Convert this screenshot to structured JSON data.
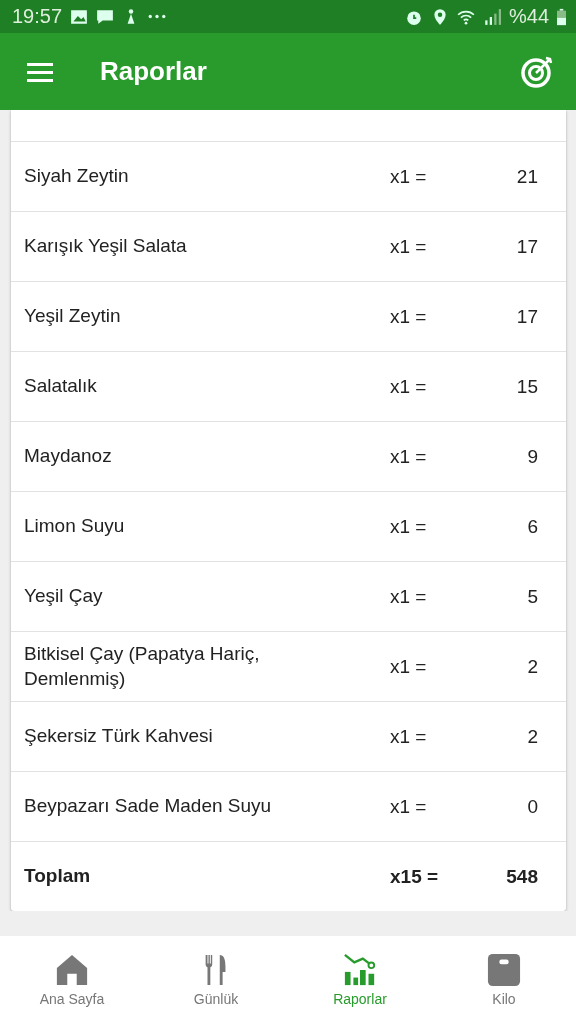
{
  "status_bar": {
    "time": "19:57",
    "battery": "%44"
  },
  "app_bar": {
    "title": "Raporlar"
  },
  "rows": [
    {
      "name": "Siyah Zeytin",
      "qty": "x1 =",
      "value": "21"
    },
    {
      "name": "Karışık Yeşil Salata",
      "qty": "x1 =",
      "value": "17"
    },
    {
      "name": "Yeşil Zeytin",
      "qty": "x1 =",
      "value": "17"
    },
    {
      "name": "Salatalık",
      "qty": "x1 =",
      "value": "15"
    },
    {
      "name": "Maydanoz",
      "qty": "x1 =",
      "value": "9"
    },
    {
      "name": "Limon Suyu",
      "qty": "x1 =",
      "value": "6"
    },
    {
      "name": "Yeşil Çay",
      "qty": "x1 =",
      "value": "5"
    },
    {
      "name": "Bitkisel Çay (Papatya Hariç, Demlenmiş)",
      "qty": "x1 =",
      "value": "2"
    },
    {
      "name": "Şekersiz Türk Kahvesi",
      "qty": "x1 =",
      "value": "2"
    },
    {
      "name": "Beypazarı Sade Maden Suyu",
      "qty": "x1 =",
      "value": "0"
    }
  ],
  "total": {
    "name": "Toplam",
    "qty": "x15 =",
    "value": "548"
  },
  "nav": [
    {
      "kind": "home",
      "label": "Ana Sayfa",
      "selected": false
    },
    {
      "kind": "diary",
      "label": "Günlük",
      "selected": false
    },
    {
      "kind": "reports",
      "label": "Raporlar",
      "selected": true
    },
    {
      "kind": "scale",
      "label": "Kilo",
      "selected": false
    }
  ]
}
